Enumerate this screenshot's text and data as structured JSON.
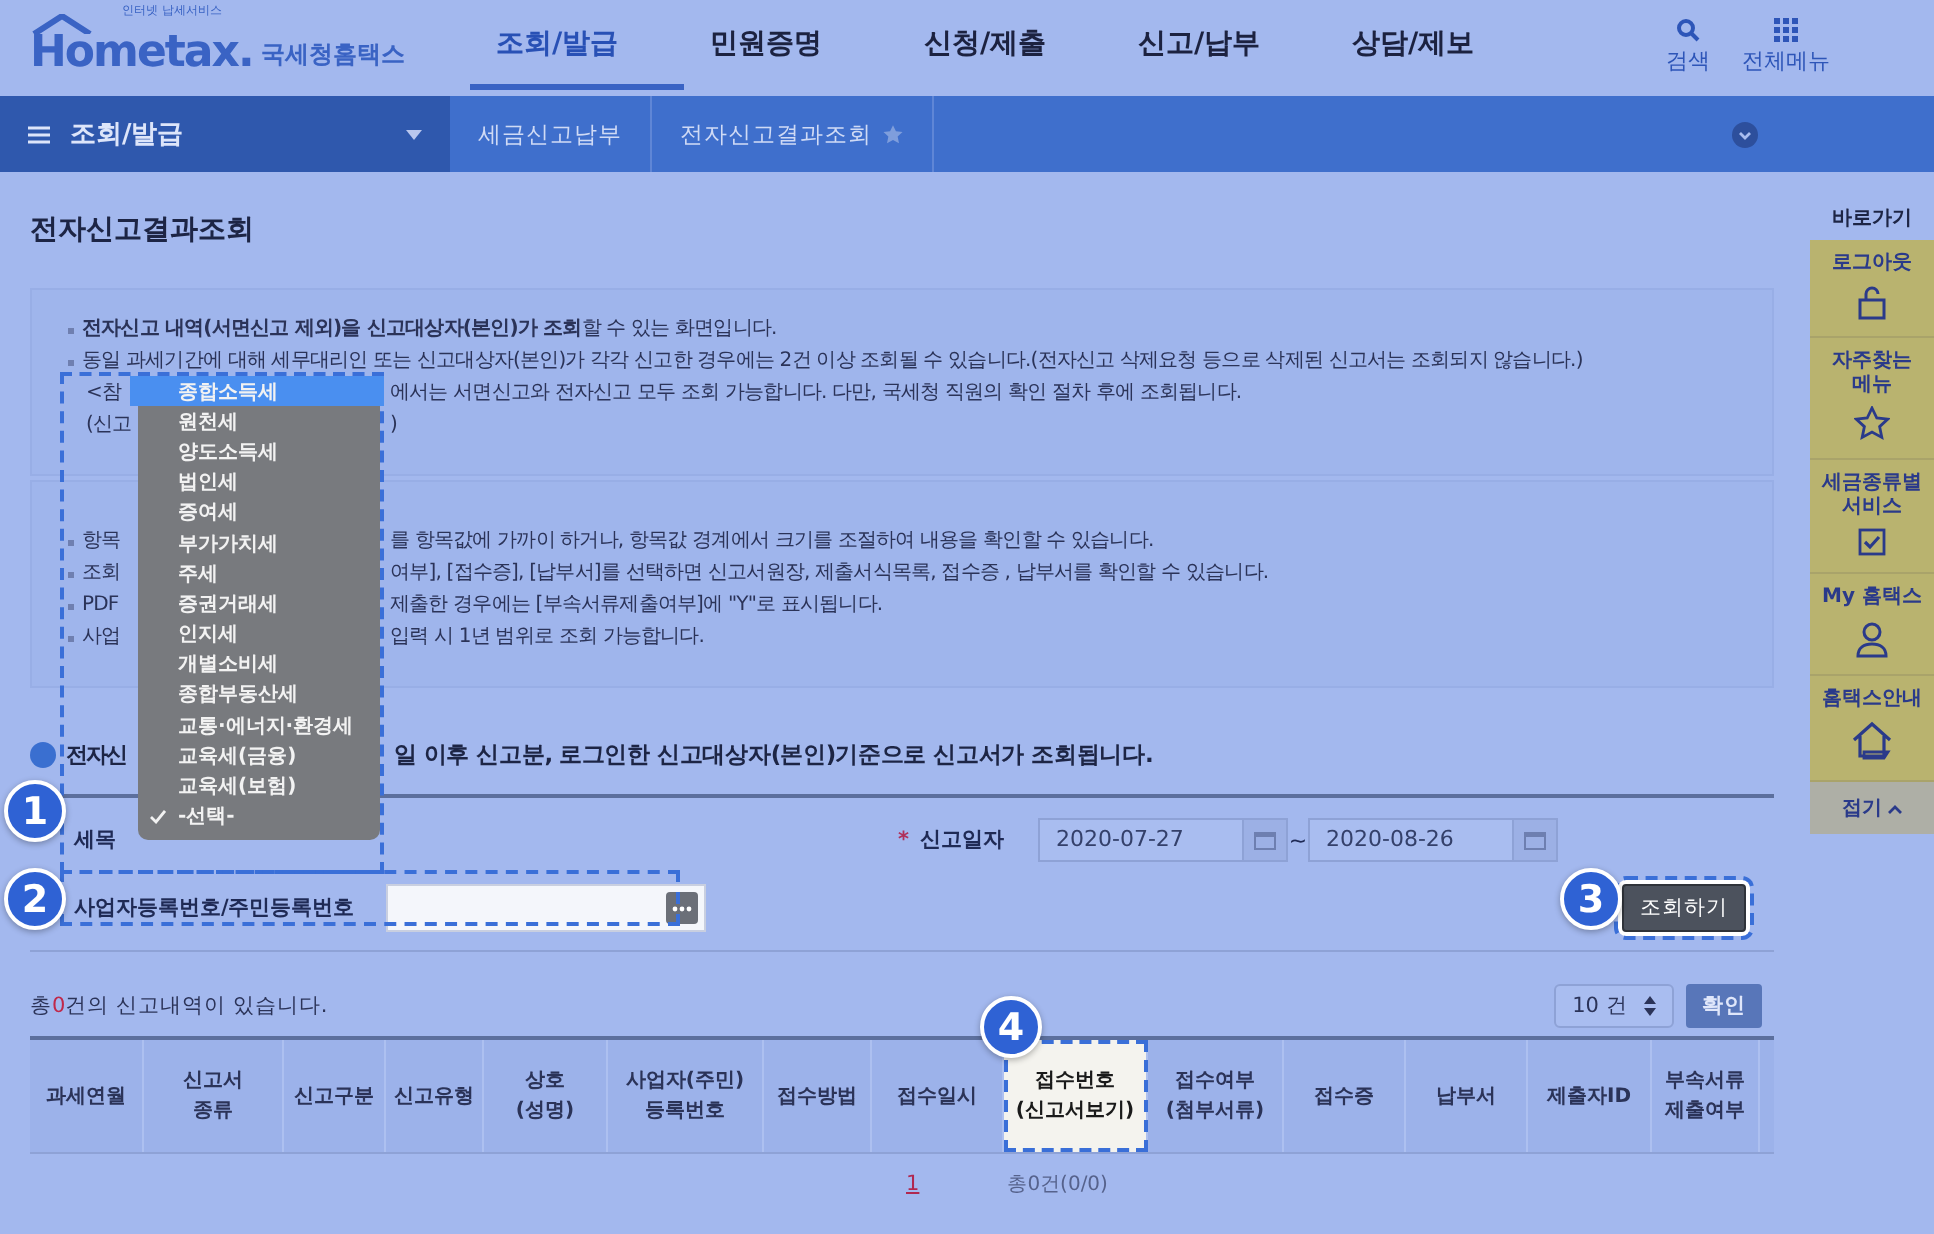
{
  "header": {
    "logo": {
      "word": "Hometax",
      "dot": ".",
      "tagline": "인터넷 납세서비스",
      "name": "국세청홈택스"
    },
    "nav": [
      {
        "label": "조회/발급",
        "selected": true
      },
      {
        "label": "민원증명",
        "selected": false
      },
      {
        "label": "신청/제출",
        "selected": false
      },
      {
        "label": "신고/납부",
        "selected": false
      },
      {
        "label": "상담/제보",
        "selected": false
      }
    ],
    "search_label": "검색",
    "all_menu_label": "전체메뉴"
  },
  "breadcrumb": {
    "menu": "조회/발급",
    "items": [
      "세금신고납부",
      "전자신고결과조회"
    ]
  },
  "page_title": "전자신고결과조회",
  "notices": [
    [
      {
        "kind": "full",
        "text": "**전자신고 내역(서면신고 제외)을 신고대상자(본인)가 조회**할 수 있는 화면입니다."
      },
      {
        "kind": "full",
        "text": "동일 과세기간에 대해 세무대리인 또는 신고대상자(본인)가 각각 신고한 경우에는 2건 이상 조회될 수 있습니다.(전자신고 삭제요청 등으로 삭제된 신고서는 조회되지 않습니다.)"
      },
      {
        "kind": "split",
        "bullet": false,
        "left": "<참",
        "right": "에서는 서면신고와 전자신고 모두 조회 가능합니다. 다만, 국세청 직원의 확인 절차 후에 조회됩니다."
      },
      {
        "kind": "split",
        "bullet": false,
        "left": "(신고",
        "right": ")"
      }
    ],
    [
      {
        "kind": "split",
        "bullet": true,
        "left": "항목",
        "right": "를 항목값에 가까이 하거나, 항목값 경계에서 크기를 조절하여 내용을 확인할 수 있습니다."
      },
      {
        "kind": "split",
        "bullet": true,
        "left": "조회",
        "right": "여부], [접수증], [납부서]를 선택하면 신고서원장, 제출서식목록, 접수증 , 납부서를 확인할 수 있습니다."
      },
      {
        "kind": "split",
        "bullet": true,
        "left": "PDF",
        "right": "제출한 경우에는 [부속서류제출여부]에 \"Y\"로  표시됩니다."
      },
      {
        "kind": "split",
        "bullet": true,
        "left": "사업",
        "right": "입력 시 1년 범위로 조회 가능합니다."
      }
    ]
  ],
  "section_heading": {
    "left": "전자신",
    "right": "일 이후 신고분, 로그인한  신고대상자(본인)기준으로  신고서가 조회됩니다."
  },
  "form": {
    "tax_label": "세목",
    "date_label": "신고일자",
    "required_mark": "*",
    "date_from": "2020-07-27",
    "date_sep": "~",
    "date_to": "2020-08-26",
    "id_label": "사업자등록번호/주민등록번호",
    "search_button": "조회하기"
  },
  "tax_dropdown": [
    {
      "label": "종합소득세",
      "selected": true,
      "checked": false
    },
    {
      "label": "원천세",
      "selected": false,
      "checked": false
    },
    {
      "label": "양도소득세",
      "selected": false,
      "checked": false
    },
    {
      "label": "법인세",
      "selected": false,
      "checked": false
    },
    {
      "label": "증여세",
      "selected": false,
      "checked": false
    },
    {
      "label": "부가가치세",
      "selected": false,
      "checked": false
    },
    {
      "label": "주세",
      "selected": false,
      "checked": false
    },
    {
      "label": "증권거래세",
      "selected": false,
      "checked": false
    },
    {
      "label": "인지세",
      "selected": false,
      "checked": false
    },
    {
      "label": "개별소비세",
      "selected": false,
      "checked": false
    },
    {
      "label": "종합부동산세",
      "selected": false,
      "checked": false
    },
    {
      "label": "교통·에너지·환경세",
      "selected": false,
      "checked": false
    },
    {
      "label": "교육세(금융)",
      "selected": false,
      "checked": false
    },
    {
      "label": "교육세(보험)",
      "selected": false,
      "checked": false
    },
    {
      "label": "-선택-",
      "selected": false,
      "checked": true
    }
  ],
  "callouts": [
    "1",
    "2",
    "3",
    "4"
  ],
  "summary": {
    "before": "총",
    "count": "0",
    "after": "건의 신고내역이 있습니다."
  },
  "page_size": "10 건",
  "confirm_button": "확인",
  "table": {
    "columns": [
      {
        "label": "과세연월",
        "highlighted": false
      },
      {
        "label": "신고서\n종류",
        "highlighted": false
      },
      {
        "label": "신고구분",
        "highlighted": false
      },
      {
        "label": "신고유형",
        "highlighted": false
      },
      {
        "label": "상호\n(성명)",
        "highlighted": false
      },
      {
        "label": "사업자(주민)\n등록번호",
        "highlighted": false
      },
      {
        "label": "접수방법",
        "highlighted": false
      },
      {
        "label": "접수일시",
        "highlighted": false
      },
      {
        "label": "접수번호\n(신고서보기)",
        "highlighted": true
      },
      {
        "label": "접수여부\n(첨부서류)",
        "highlighted": false
      },
      {
        "label": "접수증",
        "highlighted": false
      },
      {
        "label": "납부서",
        "highlighted": false
      },
      {
        "label": "제출자ID",
        "highlighted": false
      },
      {
        "label": "부속서류\n제출여부",
        "highlighted": false
      }
    ],
    "pager": "1",
    "total": "총0건(0/0)"
  },
  "quick_menu": {
    "title": "바로가기",
    "items": [
      {
        "kind": "lock",
        "label": "로그아웃"
      },
      {
        "kind": "star",
        "label": "자주찾는\n메뉴"
      },
      {
        "kind": "check",
        "label": "세금종류별\n서비스"
      },
      {
        "kind": "person",
        "label": "My 홈택스"
      },
      {
        "kind": "house",
        "label": "홈택스안내"
      }
    ],
    "fold": "접기"
  }
}
